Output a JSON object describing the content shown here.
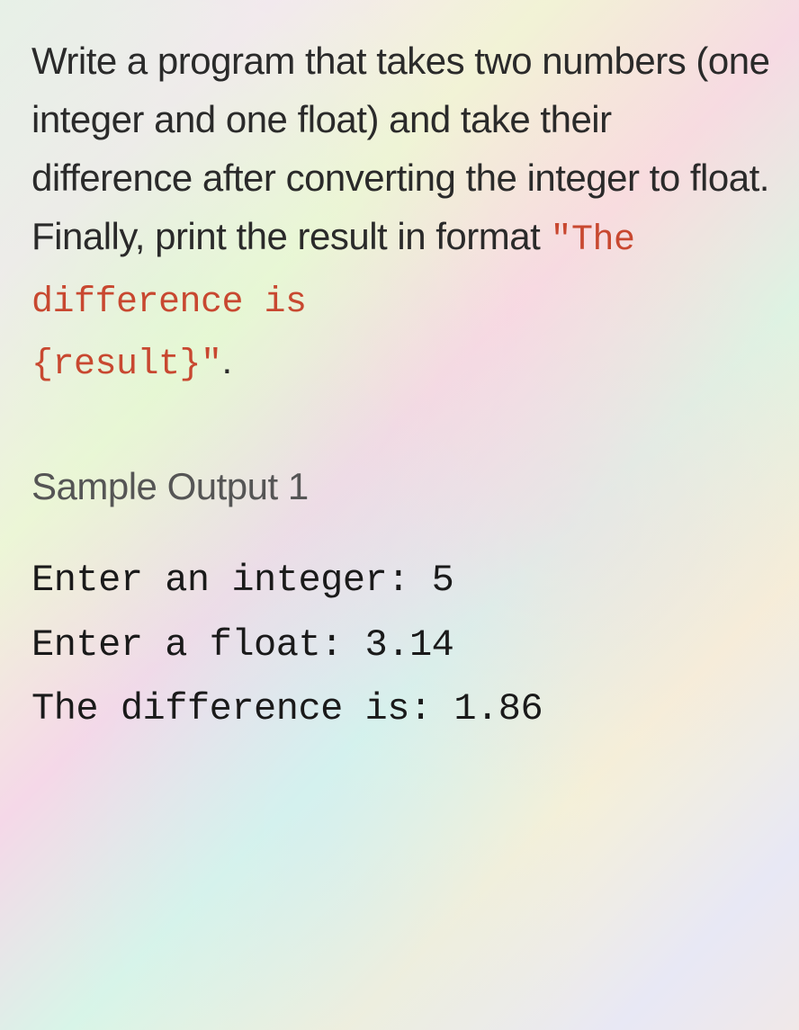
{
  "instruction": {
    "part1": "Write a program that takes two numbers (one integer and one float) and take their difference after converting the integer to float. Finally, print the result in format ",
    "code_string1": "\"The difference is",
    "code_string2": "{result}\"",
    "part2": "."
  },
  "sample_heading": "Sample Output 1",
  "sample_output": {
    "line1": "Enter an integer: 5",
    "line2": "Enter a float: 3.14",
    "line3": "The difference is: 1.86"
  }
}
